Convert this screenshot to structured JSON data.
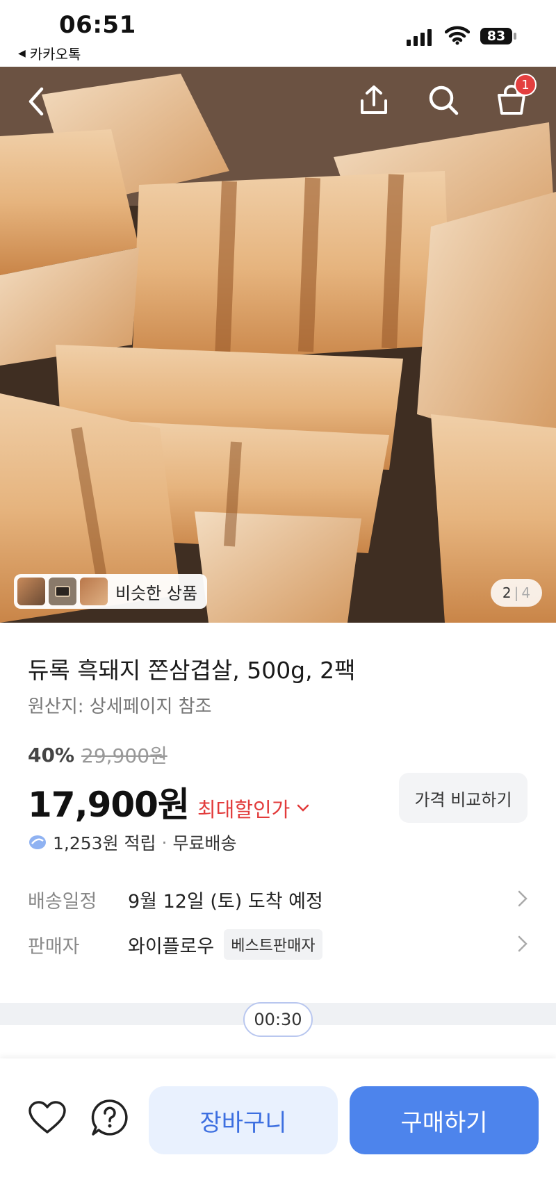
{
  "status_bar": {
    "time": "06:51",
    "back_app": "카카오톡",
    "battery": "83"
  },
  "header": {
    "back_icon": "chevron-left-icon",
    "share_icon": "share-icon",
    "search_icon": "search-icon",
    "cart_icon": "shopping-bag-icon",
    "cart_count": "1"
  },
  "gallery": {
    "similar_label": "비슷한 상품",
    "current_page": "2",
    "total_pages": "4"
  },
  "product": {
    "title": "듀록 흑돼지 쫀삼겹살, 500g, 2팩",
    "origin": "원산지: 상세페이지 참조",
    "discount_percent": "40%",
    "original_price": "29,900원",
    "price": "17,900원",
    "max_discount_label": "최대할인가",
    "compare_button": "가격 비교하기",
    "points": "1,253원 적립",
    "shipping_fee": "무료배송"
  },
  "delivery": {
    "label": "배송일정",
    "value": "9월 12일 (토) 도착 예정"
  },
  "seller": {
    "label": "판매자",
    "name": "와이플로우",
    "badge": "베스트판매자"
  },
  "timer": "00:30",
  "bottom_bar": {
    "wishlist_icon": "heart-icon",
    "inquiry_icon": "question-icon",
    "cart_button": "장바구니",
    "buy_button": "구매하기"
  },
  "colors": {
    "accent_blue": "#4d84ec",
    "discount_red": "#e23b3b",
    "badge_red": "#e43f3f"
  }
}
